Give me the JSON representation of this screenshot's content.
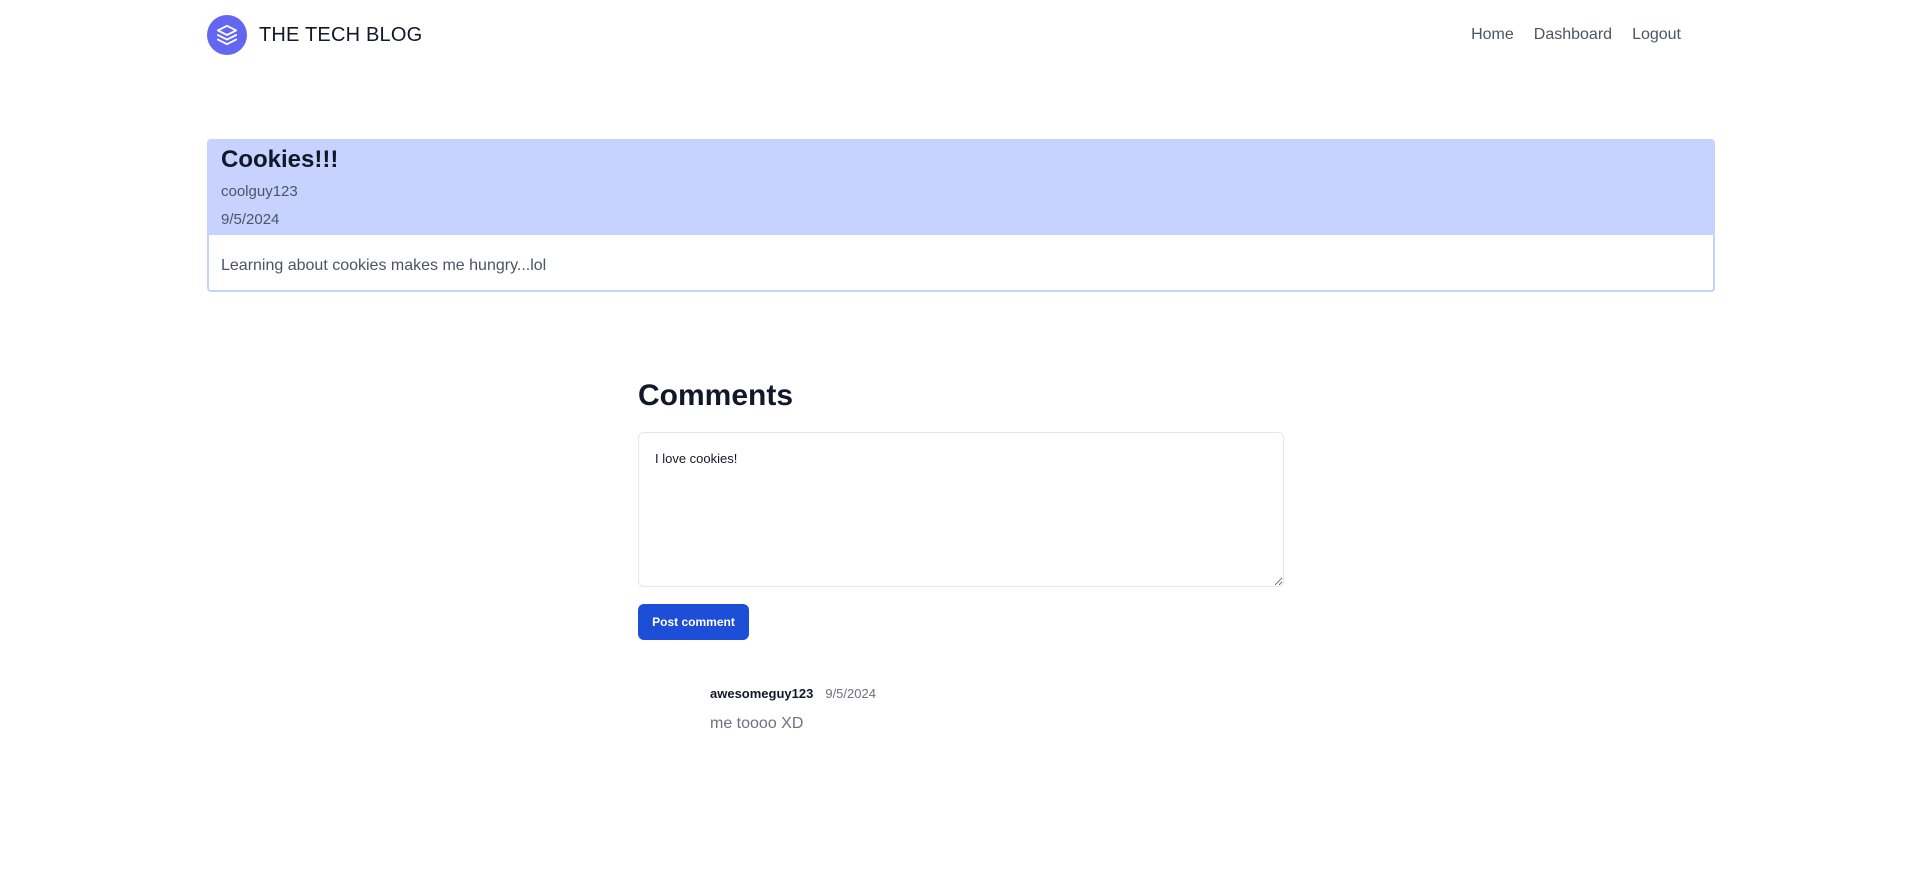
{
  "header": {
    "brand_title": "THE TECH BLOG",
    "brand_logo_icon": "layers-icon",
    "nav": {
      "home": "Home",
      "dashboard": "Dashboard",
      "logout": "Logout"
    }
  },
  "post": {
    "title": "Cookies!!!",
    "author": "coolguy123",
    "date": "9/5/2024",
    "body": "Learning about cookies makes me hungry...lol"
  },
  "comments": {
    "heading": "Comments",
    "input_value": "I love cookies!",
    "post_button": "Post comment",
    "items": [
      {
        "user": "awesomeguy123",
        "date": "9/5/2024",
        "text": "me toooo XD"
      }
    ]
  },
  "colors": {
    "brand": "#6366f1",
    "post_header_bg": "#c7d2fe",
    "button": "#1d4ed8"
  }
}
